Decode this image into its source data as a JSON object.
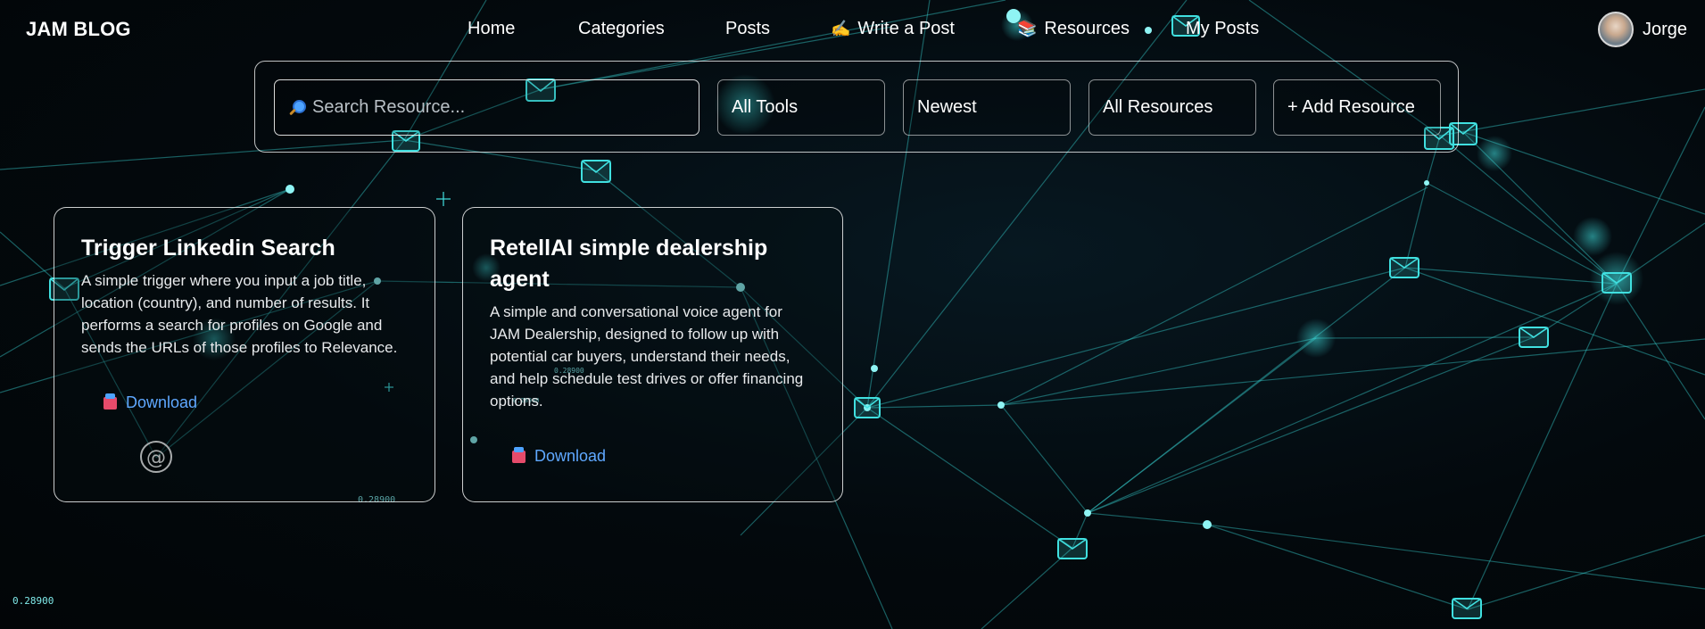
{
  "nav": {
    "brand": "JAM BLOG",
    "links": [
      {
        "label": "Home",
        "emoji": ""
      },
      {
        "label": "Categories",
        "emoji": ""
      },
      {
        "label": "Posts",
        "emoji": ""
      },
      {
        "label": "Write a Post",
        "emoji": "✍️"
      },
      {
        "label": "Resources",
        "emoji": "📚"
      },
      {
        "label": "My Posts",
        "emoji": ""
      }
    ],
    "user_name": "Jorge"
  },
  "filters": {
    "search_placeholder": "Search Resource...",
    "tool_select": "All Tools",
    "sort_select": "Newest",
    "scope_select": "All Resources",
    "add_button": "+ Add Resource"
  },
  "resources": [
    {
      "title": "Trigger Linkedin Search",
      "description": "A simple trigger where you input a job title, location (country), and number of results. It performs a search for profiles on Google and sends the URLs of those profiles to Relevance.",
      "link_label": "Download"
    },
    {
      "title": "RetellAI simple dealership agent",
      "description": "A simple and conversational voice agent for JAM Dealership, designed to follow up with potential car buyers, understand their needs, and help schedule test drives or offer financing options.",
      "link_label": "Download"
    }
  ],
  "background_labels": [
    "0.28900",
    "0.28900",
    "0.28900",
    "0.28900"
  ],
  "colors": {
    "accent": "#40e0e0",
    "link": "#5fa8ff",
    "background": "#03090d"
  }
}
